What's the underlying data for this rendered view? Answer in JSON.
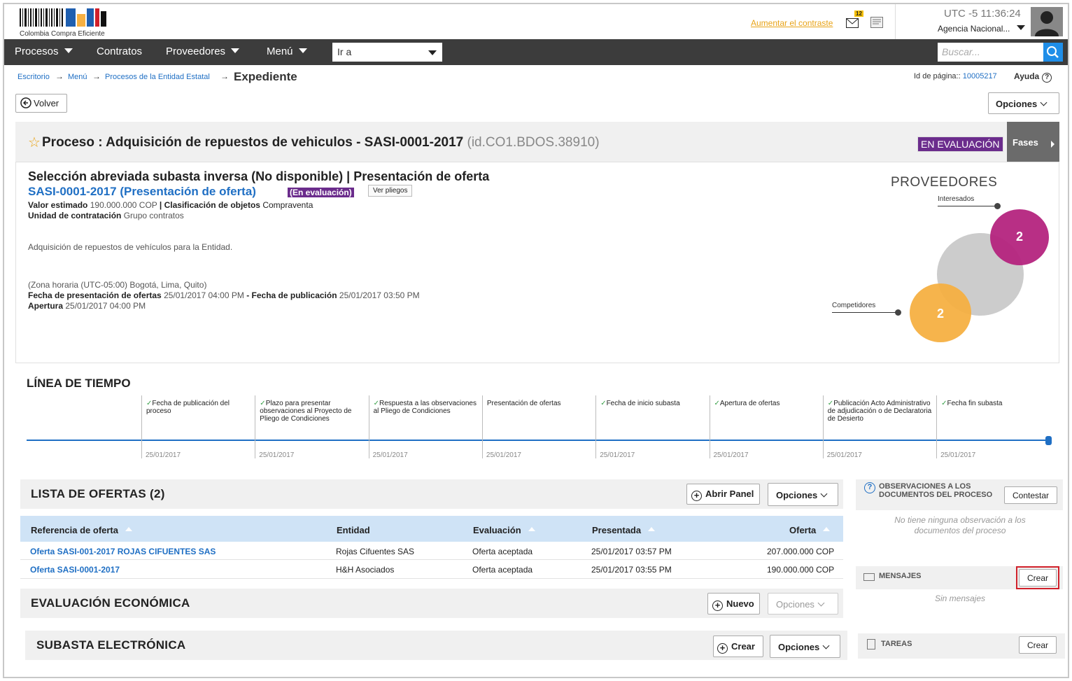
{
  "header": {
    "logo_text": "Colombia Compra Eficiente",
    "contrast_link": "Aumentar el contraste",
    "notifications_count": "12",
    "time": "UTC -5 11:36:24",
    "agency": "Agencia Nacional..."
  },
  "nav": {
    "items": [
      "Procesos",
      "Contratos",
      "Proveedores",
      "Menú"
    ],
    "goto_value": "Ir a",
    "search_placeholder": "Buscar..."
  },
  "breadcrumb": {
    "items": [
      "Escritorio",
      "Menú",
      "Procesos de la Entidad Estatal"
    ],
    "current": "Expediente",
    "page_id_label": "Id de página::",
    "page_id": "10005217",
    "help": "Ayuda"
  },
  "toolbar": {
    "back": "Volver",
    "options": "Opciones"
  },
  "process": {
    "title": "Proceso : Adquisición de repuestos de vehiculos - SASI-0001-2017",
    "id": "(id.CO1.BDOS.38910)",
    "status_badge": "EN EVALUACIÓN",
    "phases": "Fases",
    "heading": "Selección abreviada subasta inversa (No disponible) | Presentación de oferta",
    "subheading": "SASI-0001-2017 (Presentación de oferta)",
    "sub_badge": "(En evaluación)",
    "view_specs": "Ver pliegos",
    "value_label": "Valor estimado",
    "value": "190.000.000 COP",
    "classif_label": "| Clasificación de objetos",
    "classif": "Compraventa",
    "unit_label": "Unidad de contratación",
    "unit": "Grupo contratos",
    "description": "Adquisición de repuestos de vehículos para la Entidad.",
    "timezone": "(Zona horaria (UTC-05:00) Bogotá, Lima, Quito)",
    "submit_label": "Fecha de presentación de ofertas",
    "submit_date": "25/01/2017 04:00 PM",
    "pub_label": "- Fecha de publicación",
    "pub_date": "25/01/2017 03:50 PM",
    "opening_label": "Apertura",
    "opening_date": "25/01/2017 04:00 PM"
  },
  "providers": {
    "title": "PROVEEDORES",
    "interested_label": "Interesados",
    "interested": "2",
    "competitors_label": "Competidores",
    "competitors": "2",
    "colors": {
      "interested": "#b5247f",
      "competitors": "#f6b043",
      "middle": "#c7c7c7"
    }
  },
  "timeline": {
    "title": "LÍNEA DE TIEMPO",
    "events": [
      {
        "label": "Fecha de publicación del proceso",
        "date": "25/01/2017",
        "done": true
      },
      {
        "label": "Plazo para presentar observaciones al Proyecto de Pliego de Condiciones",
        "date": "25/01/2017",
        "done": true
      },
      {
        "label": "Respuesta a las observaciones al Pliego de Condiciones",
        "date": "25/01/2017",
        "done": true
      },
      {
        "label": "Presentación de ofertas",
        "date": "25/01/2017",
        "done": false
      },
      {
        "label": "Fecha de inicio subasta",
        "date": "25/01/2017",
        "done": true
      },
      {
        "label": "Apertura de ofertas",
        "date": "25/01/2017",
        "done": true
      },
      {
        "label": "Publicación Acto Administrativo de adjudicación o de Declaratoria de Desierto",
        "date": "25/01/2017",
        "done": true
      },
      {
        "label": "Fecha fin subasta",
        "date": "25/01/2017",
        "done": true
      }
    ]
  },
  "offers": {
    "title": "LISTA DE OFERTAS (2)",
    "open_panel": "Abrir Panel",
    "options": "Opciones",
    "columns": [
      "Referencia de oferta",
      "Entidad",
      "Evaluación",
      "Presentada",
      "Oferta"
    ],
    "rows": [
      [
        "Oferta SASI-001-2017 ROJAS CIFUENTES SAS",
        "Rojas Cifuentes SAS",
        "Oferta aceptada",
        "25/01/2017 03:57 PM",
        "207.000.000 COP"
      ],
      [
        "Oferta SASI-0001-2017",
        "H&H Asociados",
        "Oferta aceptada",
        "25/01/2017 03:55 PM",
        "190.000.000 COP"
      ]
    ]
  },
  "economic": {
    "title": "EVALUACIÓN ECONÓMICA",
    "new": "Nuevo",
    "options": "Opciones"
  },
  "auction": {
    "title": "SUBASTA ELECTRÓNICA",
    "create": "Crear",
    "options": "Opciones"
  },
  "observations": {
    "title": "OBSERVACIONES A LOS DOCUMENTOS DEL PROCESO",
    "reply": "Contestar",
    "empty": "No tiene ninguna observación a los documentos del proceso"
  },
  "messages": {
    "title": "MENSAJES",
    "create": "Crear",
    "empty": "Sin mensajes"
  },
  "tasks": {
    "title": "TAREAS",
    "create": "Crear"
  }
}
